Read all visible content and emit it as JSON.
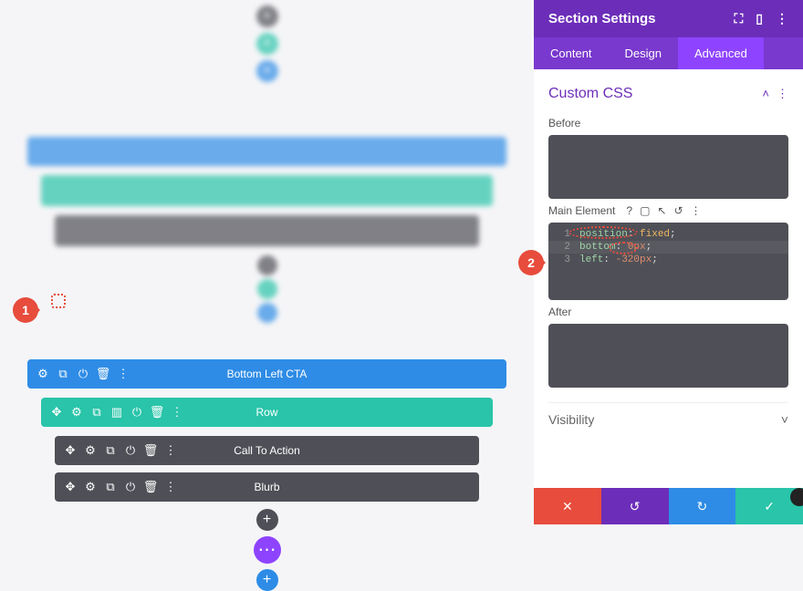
{
  "panel": {
    "title": "Section Settings",
    "tabs": {
      "content": "Content",
      "design": "Design",
      "advanced": "Advanced"
    },
    "accordion": {
      "custom_css": "Custom CSS",
      "visibility": "Visibility"
    },
    "fields": {
      "before": "Before",
      "main_element": "Main Element",
      "after": "After"
    },
    "code": {
      "l1_prop": "position",
      "l1_val": "fixed",
      "l2_prop": "bottom",
      "l2_val": "0px",
      "l3_prop": "left",
      "l3_val": "-320px"
    }
  },
  "canvas": {
    "section_label": "Bottom Left CTA",
    "row_label": "Row",
    "module_a": "Call To Action",
    "module_b": "Blurb"
  },
  "callouts": {
    "one": "1",
    "two": "2"
  },
  "colors": {
    "purple": "#6c2eb9",
    "purple_light": "#8e44ff",
    "blue": "#2e8ce6",
    "teal": "#29c4a9",
    "dark": "#4f5057",
    "red": "#e74c3c"
  }
}
